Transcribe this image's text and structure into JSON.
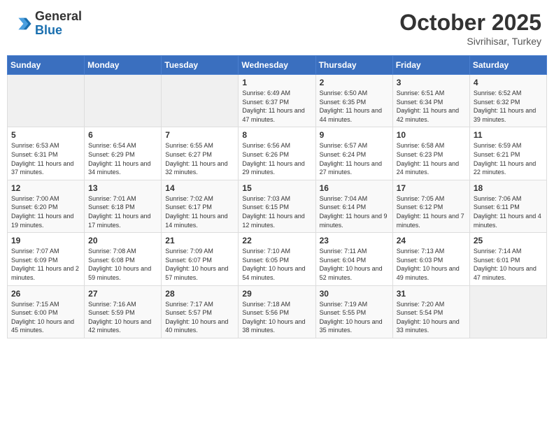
{
  "header": {
    "logo_general": "General",
    "logo_blue": "Blue",
    "month": "October 2025",
    "location": "Sivrihisar, Turkey"
  },
  "days_of_week": [
    "Sunday",
    "Monday",
    "Tuesday",
    "Wednesday",
    "Thursday",
    "Friday",
    "Saturday"
  ],
  "weeks": [
    [
      {
        "day": "",
        "info": ""
      },
      {
        "day": "",
        "info": ""
      },
      {
        "day": "",
        "info": ""
      },
      {
        "day": "1",
        "info": "Sunrise: 6:49 AM\nSunset: 6:37 PM\nDaylight: 11 hours and 47 minutes."
      },
      {
        "day": "2",
        "info": "Sunrise: 6:50 AM\nSunset: 6:35 PM\nDaylight: 11 hours and 44 minutes."
      },
      {
        "day": "3",
        "info": "Sunrise: 6:51 AM\nSunset: 6:34 PM\nDaylight: 11 hours and 42 minutes."
      },
      {
        "day": "4",
        "info": "Sunrise: 6:52 AM\nSunset: 6:32 PM\nDaylight: 11 hours and 39 minutes."
      }
    ],
    [
      {
        "day": "5",
        "info": "Sunrise: 6:53 AM\nSunset: 6:31 PM\nDaylight: 11 hours and 37 minutes."
      },
      {
        "day": "6",
        "info": "Sunrise: 6:54 AM\nSunset: 6:29 PM\nDaylight: 11 hours and 34 minutes."
      },
      {
        "day": "7",
        "info": "Sunrise: 6:55 AM\nSunset: 6:27 PM\nDaylight: 11 hours and 32 minutes."
      },
      {
        "day": "8",
        "info": "Sunrise: 6:56 AM\nSunset: 6:26 PM\nDaylight: 11 hours and 29 minutes."
      },
      {
        "day": "9",
        "info": "Sunrise: 6:57 AM\nSunset: 6:24 PM\nDaylight: 11 hours and 27 minutes."
      },
      {
        "day": "10",
        "info": "Sunrise: 6:58 AM\nSunset: 6:23 PM\nDaylight: 11 hours and 24 minutes."
      },
      {
        "day": "11",
        "info": "Sunrise: 6:59 AM\nSunset: 6:21 PM\nDaylight: 11 hours and 22 minutes."
      }
    ],
    [
      {
        "day": "12",
        "info": "Sunrise: 7:00 AM\nSunset: 6:20 PM\nDaylight: 11 hours and 19 minutes."
      },
      {
        "day": "13",
        "info": "Sunrise: 7:01 AM\nSunset: 6:18 PM\nDaylight: 11 hours and 17 minutes."
      },
      {
        "day": "14",
        "info": "Sunrise: 7:02 AM\nSunset: 6:17 PM\nDaylight: 11 hours and 14 minutes."
      },
      {
        "day": "15",
        "info": "Sunrise: 7:03 AM\nSunset: 6:15 PM\nDaylight: 11 hours and 12 minutes."
      },
      {
        "day": "16",
        "info": "Sunrise: 7:04 AM\nSunset: 6:14 PM\nDaylight: 11 hours and 9 minutes."
      },
      {
        "day": "17",
        "info": "Sunrise: 7:05 AM\nSunset: 6:12 PM\nDaylight: 11 hours and 7 minutes."
      },
      {
        "day": "18",
        "info": "Sunrise: 7:06 AM\nSunset: 6:11 PM\nDaylight: 11 hours and 4 minutes."
      }
    ],
    [
      {
        "day": "19",
        "info": "Sunrise: 7:07 AM\nSunset: 6:09 PM\nDaylight: 11 hours and 2 minutes."
      },
      {
        "day": "20",
        "info": "Sunrise: 7:08 AM\nSunset: 6:08 PM\nDaylight: 10 hours and 59 minutes."
      },
      {
        "day": "21",
        "info": "Sunrise: 7:09 AM\nSunset: 6:07 PM\nDaylight: 10 hours and 57 minutes."
      },
      {
        "day": "22",
        "info": "Sunrise: 7:10 AM\nSunset: 6:05 PM\nDaylight: 10 hours and 54 minutes."
      },
      {
        "day": "23",
        "info": "Sunrise: 7:11 AM\nSunset: 6:04 PM\nDaylight: 10 hours and 52 minutes."
      },
      {
        "day": "24",
        "info": "Sunrise: 7:13 AM\nSunset: 6:03 PM\nDaylight: 10 hours and 49 minutes."
      },
      {
        "day": "25",
        "info": "Sunrise: 7:14 AM\nSunset: 6:01 PM\nDaylight: 10 hours and 47 minutes."
      }
    ],
    [
      {
        "day": "26",
        "info": "Sunrise: 7:15 AM\nSunset: 6:00 PM\nDaylight: 10 hours and 45 minutes."
      },
      {
        "day": "27",
        "info": "Sunrise: 7:16 AM\nSunset: 5:59 PM\nDaylight: 10 hours and 42 minutes."
      },
      {
        "day": "28",
        "info": "Sunrise: 7:17 AM\nSunset: 5:57 PM\nDaylight: 10 hours and 40 minutes."
      },
      {
        "day": "29",
        "info": "Sunrise: 7:18 AM\nSunset: 5:56 PM\nDaylight: 10 hours and 38 minutes."
      },
      {
        "day": "30",
        "info": "Sunrise: 7:19 AM\nSunset: 5:55 PM\nDaylight: 10 hours and 35 minutes."
      },
      {
        "day": "31",
        "info": "Sunrise: 7:20 AM\nSunset: 5:54 PM\nDaylight: 10 hours and 33 minutes."
      },
      {
        "day": "",
        "info": ""
      }
    ]
  ]
}
